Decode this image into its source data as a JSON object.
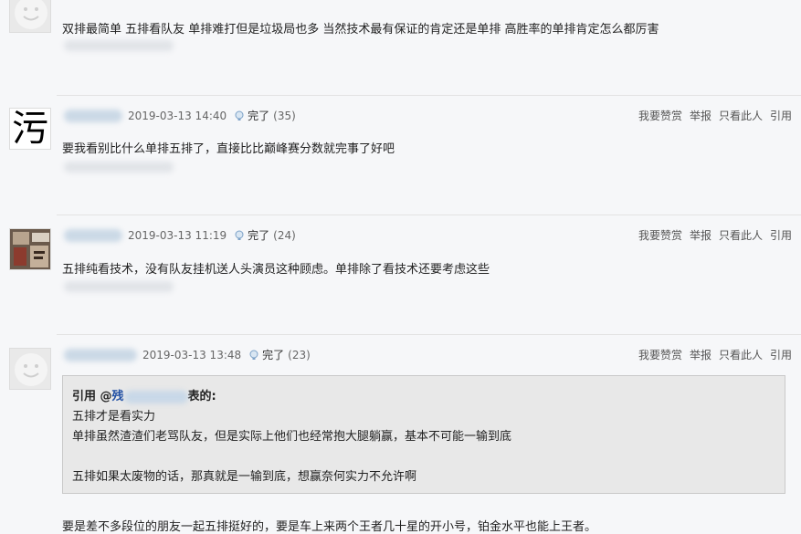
{
  "posts": [
    {
      "content": "双排最简单 五排看队友 单排难打但是垃圾局也多 当然技术最有保证的肯定还是单排 高胜率的单排肯定怎么都厉害"
    },
    {
      "avatar_char": "污",
      "time": "2019-03-13 14:40",
      "reaction_label": "完了",
      "reaction_count": "(35)",
      "content": "要我看别比什么单排五排了，直接比比巅峰赛分数就完事了好吧"
    },
    {
      "time": "2019-03-13 11:19",
      "reaction_label": "完了",
      "reaction_count": "(24)",
      "content": "五排纯看技术，没有队友挂机送人头演员这种顾虑。单排除了看技术还要考虑这些"
    },
    {
      "time": "2019-03-13 13:48",
      "reaction_label": "完了",
      "reaction_count": "(23)",
      "quote": {
        "prefix": "引用 @",
        "at_name": "残",
        "suffix": "表的:",
        "lines": [
          "五排才是看实力",
          "单排虽然渣渣们老骂队友，但是实际上他们也经常抱大腿躺赢，基本不可能一输到底"
        ],
        "last_line": "五排如果太废物的话，那真就是一输到底，想赢奈何实力不允许啊"
      },
      "content": "要是差不多段位的朋友一起五排挺好的，要是车上来两个王者几十星的开小号，铂金水平也能上王者。"
    }
  ],
  "actions": {
    "tip": "我要赞赏",
    "report": "举报",
    "only_this": "只看此人",
    "quote": "引用"
  }
}
